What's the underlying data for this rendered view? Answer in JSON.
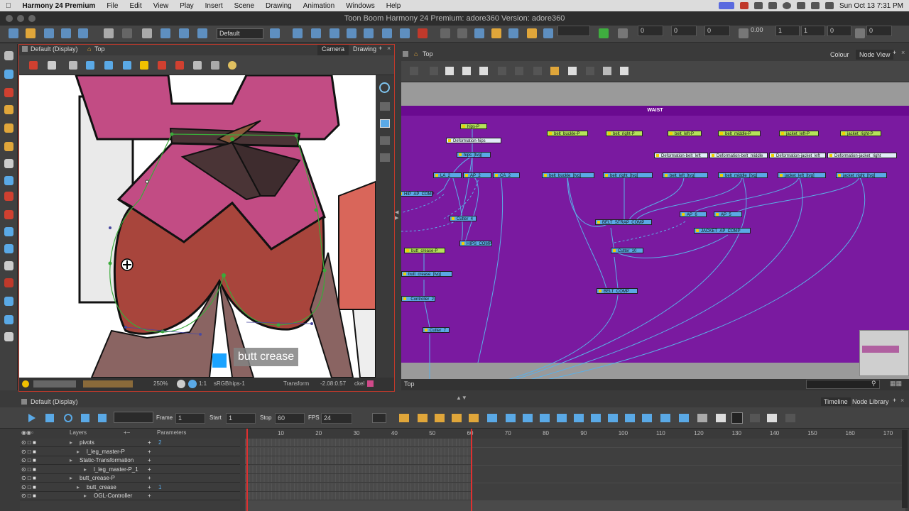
{
  "menubar": {
    "app_name": "Harmony 24 Premium",
    "items": [
      "File",
      "Edit",
      "View",
      "Play",
      "Insert",
      "Scene",
      "Drawing",
      "Animation",
      "Windows",
      "Help"
    ],
    "clock": "Sun Oct 13  7:31 PM"
  },
  "window": {
    "title": "Toon Boom Harmony 24 Premium: adore360 Version: adore360"
  },
  "toolbar": {
    "workspace": "Default",
    "fields": [
      "0",
      "0",
      "0",
      "0.00",
      "1",
      "1",
      "0",
      "0"
    ]
  },
  "camera_panel": {
    "display": "Default (Display)",
    "breadcrumb": "Top",
    "tabs": [
      "Camera",
      "Drawing"
    ],
    "tooltip": "butt crease",
    "status": {
      "zoom": "250%",
      "ratio": "1:1",
      "color_space": "sRGB",
      "layer": "hips-1",
      "tool": "Transform",
      "coords": "-2.08:0.57",
      "sel": "ckel"
    }
  },
  "node_view": {
    "breadcrumb": "Top",
    "tabs": [
      "Colour",
      "Node View"
    ],
    "backdrop_title": "WAIST",
    "status_path": "Top",
    "nodes": [
      {
        "id": "n1",
        "label": "hips-P",
        "kind": "p"
      },
      {
        "id": "n2",
        "label": "Deformation-hips",
        "kind": "d"
      },
      {
        "id": "n3",
        "label": "hips_[tvg]",
        "kind": "t"
      },
      {
        "id": "n4",
        "label": "LA_2",
        "kind": "t"
      },
      {
        "id": "n5",
        "label": "AP_2",
        "kind": "t"
      },
      {
        "id": "n6",
        "label": "CA_2",
        "kind": "t"
      },
      {
        "id": "n7",
        "label": "HIP_AP_COMP",
        "kind": "c"
      },
      {
        "id": "n8",
        "label": "Cutter_4",
        "kind": "t"
      },
      {
        "id": "n9",
        "label": "HIPS_COMP",
        "kind": "c"
      },
      {
        "id": "n10",
        "label": "butt_crease-P",
        "kind": "p"
      },
      {
        "id": "n11",
        "label": "butt_crease_[tvg]",
        "kind": "t"
      },
      {
        "id": "n12",
        "label": "_Controller_2",
        "kind": "t"
      },
      {
        "id": "n13",
        "label": "Cutter_7",
        "kind": "t"
      },
      {
        "id": "n14",
        "label": "belt_buckle-P",
        "kind": "p"
      },
      {
        "id": "n15",
        "label": "belt_right-P",
        "kind": "p"
      },
      {
        "id": "n16",
        "label": "belt_left-P",
        "kind": "p"
      },
      {
        "id": "n17",
        "label": "belt_middle-P",
        "kind": "p"
      },
      {
        "id": "n18",
        "label": "jacket_left-P",
        "kind": "p"
      },
      {
        "id": "n19",
        "label": "jacket_right-P",
        "kind": "p"
      },
      {
        "id": "n20",
        "label": "Deformation-belt_left",
        "kind": "d"
      },
      {
        "id": "n21",
        "label": "Deformation-belt_middle",
        "kind": "d"
      },
      {
        "id": "n22",
        "label": "Deformation-jacket_left",
        "kind": "d"
      },
      {
        "id": "n23",
        "label": "Deformation-jacket_right",
        "kind": "d"
      },
      {
        "id": "n24",
        "label": "belt_buckle_[tvg]",
        "kind": "t"
      },
      {
        "id": "n25",
        "label": "belt_right_[tvg]",
        "kind": "t"
      },
      {
        "id": "n26",
        "label": "belt_left_[tvg]",
        "kind": "t"
      },
      {
        "id": "n27",
        "label": "belt_middle_[tvg]",
        "kind": "t"
      },
      {
        "id": "n28",
        "label": "jacket_left_[tvg]",
        "kind": "t"
      },
      {
        "id": "n29",
        "label": "jacket_right_[tvg]",
        "kind": "t"
      },
      {
        "id": "n30",
        "label": "BELT_STRAP_COMP",
        "kind": "c"
      },
      {
        "id": "n31",
        "label": "AP_6",
        "kind": "t"
      },
      {
        "id": "n32",
        "label": "AP_5",
        "kind": "t"
      },
      {
        "id": "n33",
        "label": "JACKET_AP_COMP",
        "kind": "c"
      },
      {
        "id": "n34",
        "label": "Cutter_10",
        "kind": "t"
      },
      {
        "id": "n35",
        "label": "BELT_COMP",
        "kind": "c"
      }
    ]
  },
  "timeline": {
    "display": "Default (Display)",
    "tabs": [
      "Timeline",
      "Node Library"
    ],
    "frame_label": "Frame",
    "frame": "1",
    "start_label": "Start",
    "start": "1",
    "stop_label": "Stop",
    "stop": "60",
    "fps_label": "FPS",
    "fps": "24",
    "layers_header": "Layers",
    "params_header": "Parameters",
    "ruler": [
      "10",
      "20",
      "30",
      "40",
      "50",
      "60",
      "70",
      "80",
      "90",
      "100",
      "110",
      "120",
      "130",
      "140",
      "150",
      "160",
      "170"
    ],
    "layers": [
      {
        "name": "pivots",
        "indent": 0,
        "param": "2"
      },
      {
        "name": "l_leg_master-P",
        "indent": 1,
        "param": ""
      },
      {
        "name": "Static-Transformation",
        "indent": 0,
        "param": ""
      },
      {
        "name": "l_leg_master-P_1",
        "indent": 2,
        "param": ""
      },
      {
        "name": "butt_crease-P",
        "indent": 0,
        "param": ""
      },
      {
        "name": "butt_crease",
        "indent": 1,
        "param": "1"
      },
      {
        "name": "OGL-Controller",
        "indent": 2,
        "param": ""
      }
    ]
  },
  "colors": {
    "backdrop": "#7a1aa0",
    "selection": "#c0392b",
    "accent": "#5aa9e6"
  }
}
